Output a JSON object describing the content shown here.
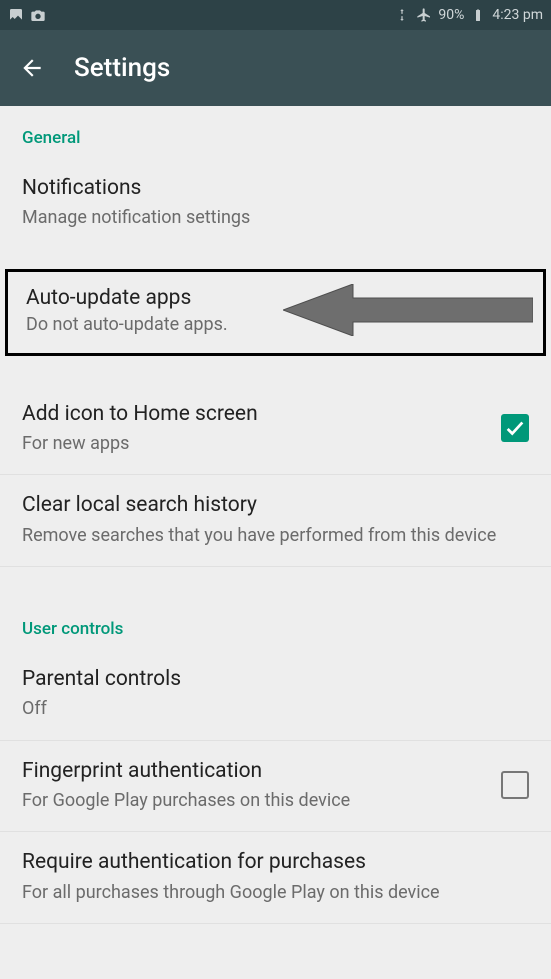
{
  "statusbar": {
    "battery_pct": "90%",
    "time": "4:23 pm"
  },
  "appbar": {
    "title": "Settings"
  },
  "sections": {
    "general": {
      "header": "General",
      "notifications": {
        "title": "Notifications",
        "sub": "Manage notification settings"
      },
      "auto_update": {
        "title": "Auto-update apps",
        "sub": "Do not auto-update apps."
      },
      "add_icon": {
        "title": "Add icon to Home screen",
        "sub": "For new apps",
        "checked": true
      },
      "clear_history": {
        "title": "Clear local search history",
        "sub": "Remove searches that you have performed from this device"
      }
    },
    "user_controls": {
      "header": "User controls",
      "parental": {
        "title": "Parental controls",
        "sub": "Off"
      },
      "fingerprint": {
        "title": "Fingerprint authentication",
        "sub": "For Google Play purchases on this device",
        "checked": false
      },
      "require_auth": {
        "title": "Require authentication for purchases",
        "sub": "For all purchases through Google Play on this device"
      }
    }
  }
}
